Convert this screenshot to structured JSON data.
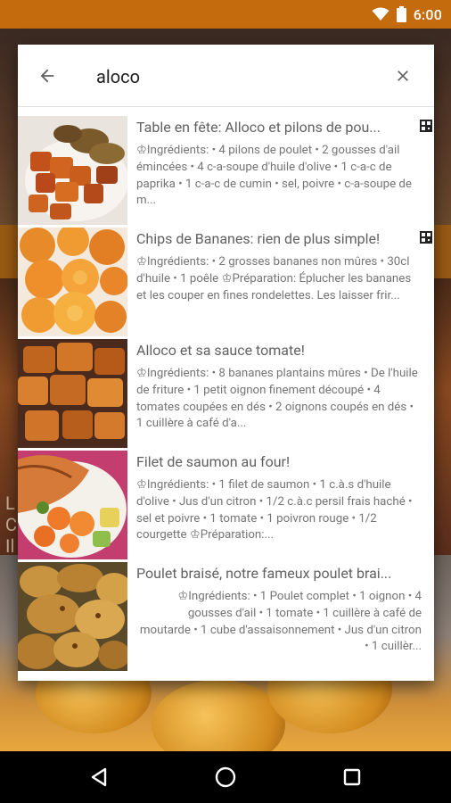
{
  "status_bar": {
    "time": "6:00"
  },
  "background": {
    "partial_text": "L\nC\nIl"
  },
  "search": {
    "query": "aloco"
  },
  "results": [
    {
      "title": "Table en fête: Alloco et pilons de pou...",
      "description": "♔Ingrédients: • 4 pilons de poulet • 2 gousses d'ail émincées • 4 c-a-soupe d'huile d'olive • 1 c-a-c de paprika • 1 c-a-c de cumin • sel, poivre • c-a-soupe de m...",
      "has_badge": true,
      "image": "sweet-potato"
    },
    {
      "title": "Chips de Bananes: rien de plus simple!",
      "description": "♔Ingrédients: • 2 grosses bananes non mûres • 30cl d'huile • 1 poêle ♔Préparation: Éplucher les bananes et les couper en fines rondelettes. Les laisser frir...",
      "has_badge": true,
      "image": "chips"
    },
    {
      "title": "Alloco et sa sauce tomate!",
      "description": "♔Ingrédients: • 8 bananes plantains mûres • De l'huile de friture • 1 petit oignon finement découpé • 4 tomates coupées en dés • 2 oignons coupés en dés • 1 cuillère à café d'a...",
      "has_badge": false,
      "image": "alloco"
    },
    {
      "title": "Filet de saumon au four!",
      "description": "♔Ingrédients: • 1 filet de saumon • 1 c.à.s d'huile d'olive • Jus d'un citron • 1/2 c.à.c persil frais haché • sel et poivre • 1 tomate • 1 poivron rouge • 1/2 courgette ♔Préparation:...",
      "has_badge": false,
      "image": "salmon"
    },
    {
      "title": "Poulet braisé, notre fameux poulet brai...",
      "description": "♔Ingrédients: • 1 Poulet complet • 1 oignon • 4 gousses d'ail • 1 tomate • 1 cuillère à café de moutarde • 1 cube d'assaisonnement • Jus d'un citron • 1 cuillèr...",
      "has_badge": false,
      "image": "chicken"
    }
  ],
  "icons": {
    "back": "arrow-left-icon",
    "clear": "close-icon",
    "nav_back": "triangle-back-icon",
    "nav_home": "circle-home-icon",
    "nav_recents": "square-recents-icon"
  },
  "colors": {
    "status_bar": "#c46b0e",
    "nav_bar": "#000000",
    "dialog": "#ffffff"
  }
}
